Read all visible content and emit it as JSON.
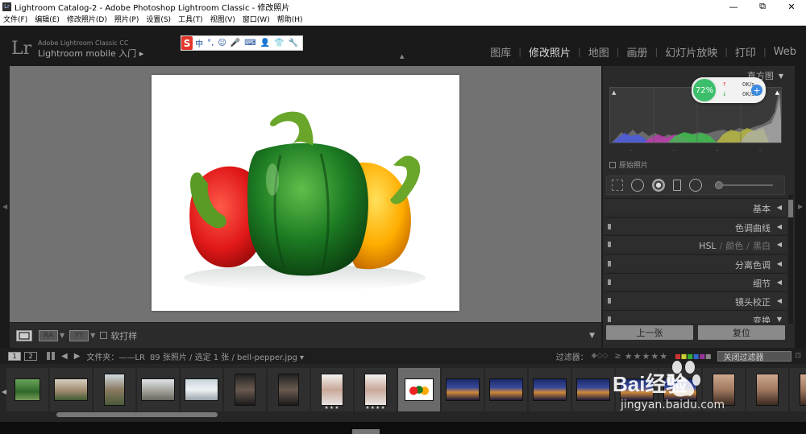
{
  "window": {
    "title": "Lightroom Catalog-2 - Adobe Photoshop Lightroom Classic - 修改照片",
    "app_icon": "Lr",
    "controls": [
      "—",
      "⧉",
      "✕"
    ]
  },
  "menu": [
    "文件(F)",
    "编辑(E)",
    "修改照片(D)",
    "照片(P)",
    "设置(S)",
    "工具(T)",
    "视图(V)",
    "窗口(W)",
    "帮助(H)"
  ],
  "identity": {
    "logo": "Lr",
    "line1": "Adobe Lightroom Classic CC",
    "line2": "Lightroom mobile 入门 ▸"
  },
  "ime": {
    "logo": "S",
    "items": [
      "中",
      "°,",
      "☺",
      "🎤",
      "⌨",
      "👤",
      "👕",
      "🔧"
    ]
  },
  "modules": [
    {
      "label": "图库",
      "active": false
    },
    {
      "label": "修改照片",
      "active": true
    },
    {
      "label": "地图",
      "active": false
    },
    {
      "label": "画册",
      "active": false
    },
    {
      "label": "幻灯片放映",
      "active": false
    },
    {
      "label": "打印",
      "active": false
    },
    {
      "label": "Web",
      "active": false
    }
  ],
  "toolbar": {
    "btn_ra": "RA",
    "btn_yy": "YY",
    "softproof_label": "软打样"
  },
  "right_panel": {
    "histogram_title": "直方图",
    "original_photo_label": "原始照片",
    "net_widget": {
      "percent": "72%",
      "up": "0K/s",
      "down": "0K/s",
      "plus": "+"
    },
    "sections": [
      {
        "label": "基本",
        "toggle": false
      },
      {
        "label": "色调曲线",
        "toggle": true
      },
      {
        "label": "HSL",
        "sub1": "颜色",
        "sub2": "黑白",
        "toggle": true
      },
      {
        "label": "分离色调",
        "toggle": true
      },
      {
        "label": "细节",
        "toggle": true
      },
      {
        "label": "镜头校正",
        "toggle": true
      },
      {
        "label": "变换",
        "toggle": true
      }
    ],
    "prev_button": "上一张",
    "reset_button": "复位"
  },
  "filmbar": {
    "monitor1": "1",
    "monitor2": "2",
    "source_label": "文件夹：——LR",
    "info": "89 张照片 / 选定 1 张 / bell-pepper.jpg ▾",
    "filter_label": "过滤器：",
    "filter_value": "关闭过滤器"
  },
  "filmstrip": {
    "selected_file": "bell-pepper.jpg",
    "thumbs": [
      {
        "type": "green-landscape",
        "stars": ""
      },
      {
        "type": "castle",
        "stars": ""
      },
      {
        "type": "castle-portrait",
        "stars": ""
      },
      {
        "type": "town",
        "stars": ""
      },
      {
        "type": "snow",
        "stars": ""
      },
      {
        "type": "portrait-dark",
        "stars": ""
      },
      {
        "type": "portrait-dark",
        "stars": ""
      },
      {
        "type": "portrait-light",
        "stars": "★★★"
      },
      {
        "type": "portrait-light",
        "stars": "★★★★"
      },
      {
        "type": "peppers",
        "stars": ""
      },
      {
        "type": "night-city",
        "stars": ""
      },
      {
        "type": "night-city",
        "stars": ""
      },
      {
        "type": "night-city",
        "stars": ""
      },
      {
        "type": "night-city",
        "stars": ""
      },
      {
        "type": "night-city",
        "stars": ""
      },
      {
        "type": "night-city",
        "stars": ""
      },
      {
        "type": "portrait-warm",
        "stars": ""
      },
      {
        "type": "portrait-warm",
        "stars": ""
      },
      {
        "type": "portrait-warm",
        "stars": ""
      }
    ]
  },
  "watermark": {
    "brand": "Bai经验",
    "url": "jingyan.baidu.com"
  },
  "colors": {
    "canvas_bg": "#727272",
    "panel_bg": "#2a2a2a",
    "accent_active": "#dddddd",
    "net_green": "#3cbf6b",
    "ime_red": "#e4362b"
  }
}
